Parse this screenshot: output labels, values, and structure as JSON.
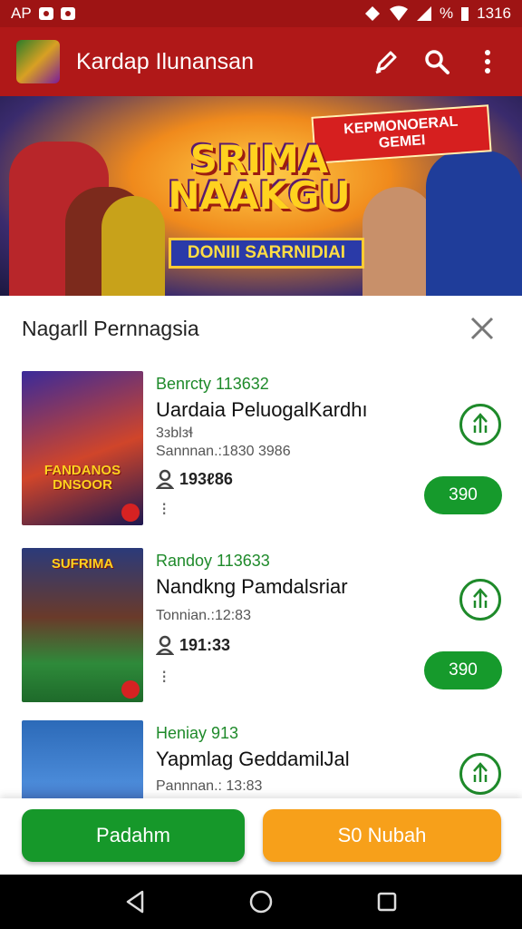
{
  "status_bar": {
    "left_text": "AP",
    "battery": "%",
    "time": "1316"
  },
  "app_bar": {
    "title": "Kardap Ilunansan",
    "icons": [
      "edit-pen-icon",
      "search-icon",
      "more-vert-icon"
    ]
  },
  "banner": {
    "tag": "KEPMONOERAL GEMEI",
    "title_line1": "SRIMA",
    "title_line2": "NAAKGU",
    "subtitle": "DONIII SARRNIDIAI"
  },
  "sheet": {
    "title": "Nagarll Pernnagsia",
    "items": [
      {
        "sub": "Benrcty 113632",
        "title": "Uardaia PeluogalKardhı",
        "line1": "3ᴈblᴈɬ",
        "line2": "Sannnan.:1830 3986",
        "users": "193ℓ86",
        "price": "390",
        "thumb_caption": "FANDANOS DNSOOR"
      },
      {
        "sub": "Randoy 113633",
        "title": "Nandkng Pamdalsriar",
        "line1": "Tonnian.:12:83",
        "line2": "",
        "users": "191:33",
        "price": "390",
        "thumb_caption": "SUFRIMA"
      },
      {
        "sub": "Heniay 913",
        "title": "Yapmlag GeddamilJal",
        "line1": "Pannnan.: 13:83",
        "line2": "",
        "users": "",
        "price": "",
        "thumb_caption": ""
      }
    ]
  },
  "actions": {
    "primary": "Padahm",
    "secondary": "S0 Nubah"
  },
  "colors": {
    "app_bar": "#b01818",
    "status_bar": "#9e1414",
    "green": "#16982a",
    "orange": "#f7a01a"
  }
}
